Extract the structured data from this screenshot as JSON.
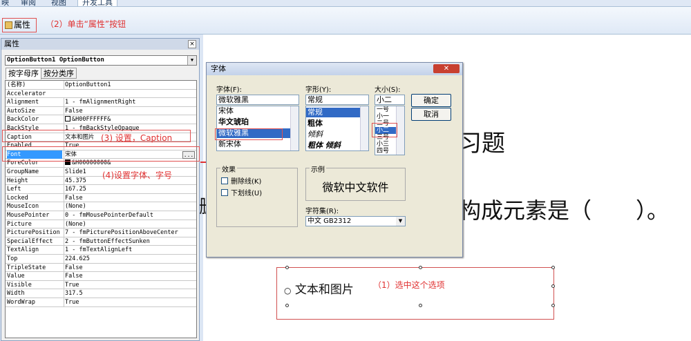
{
  "ribbon": {
    "tabs": [
      "映",
      "审阅",
      "视图",
      "开发工具"
    ],
    "properties_btn": "属性"
  },
  "annotations": {
    "a1": "（1）选中这个选项",
    "a2": "（2）单击“属性”按钮",
    "a3": "(3) 设置，Caption",
    "a4": "(4)设置字体、字号"
  },
  "props": {
    "title": "属性",
    "object": "OptionButton1 OptionButton",
    "tab_alpha": "按字母序",
    "tab_cat": "按分类序",
    "rows": [
      [
        "(名称)",
        "OptionButton1"
      ],
      [
        "Accelerator",
        ""
      ],
      [
        "Alignment",
        "1 - fmAlignmentRight"
      ],
      [
        "AutoSize",
        "False"
      ],
      [
        "BackColor",
        "&H00FFFFFF&"
      ],
      [
        "BackStyle",
        "1 - fmBackStyleOpaque"
      ],
      [
        "Caption",
        "文本和图片"
      ],
      [
        "Enabled",
        "True"
      ],
      [
        "Font",
        "宋体"
      ],
      [
        "ForeColor",
        "&H00000000&"
      ],
      [
        "GroupName",
        "Slide1"
      ],
      [
        "Height",
        "45.375"
      ],
      [
        "Left",
        "167.25"
      ],
      [
        "Locked",
        "False"
      ],
      [
        "MouseIcon",
        "(None)"
      ],
      [
        "MousePointer",
        "0 - fmMousePointerDefault"
      ],
      [
        "Picture",
        "(None)"
      ],
      [
        "PicturePosition",
        "7 - fmPicturePositionAboveCenter"
      ],
      [
        "SpecialEffect",
        "2 - fmButtonEffectSunken"
      ],
      [
        "TextAlign",
        "1 - fmTextAlignLeft"
      ],
      [
        "Top",
        "224.625"
      ],
      [
        "TripleState",
        "False"
      ],
      [
        "Value",
        "False"
      ],
      [
        "Visible",
        "True"
      ],
      [
        "Width",
        "317.5"
      ],
      [
        "WordWrap",
        "True"
      ]
    ]
  },
  "dialog": {
    "title": "字体",
    "font_label": "字体(F):",
    "font_value": "微软雅黑",
    "fonts": [
      "宋体",
      "华文琥珀",
      "微软雅黑",
      "新宋体"
    ],
    "style_label": "字形(Y):",
    "style_value": "常规",
    "styles": [
      "常规",
      "粗体",
      "倾斜",
      "粗体 倾斜"
    ],
    "size_label": "大小(S):",
    "size_value": "小二",
    "sizes": [
      "一号",
      "小一",
      "二号",
      "小二",
      "三号",
      "小三",
      "四号"
    ],
    "ok": "确定",
    "cancel": "取消",
    "effects": "效果",
    "strike": "删除线(K)",
    "underline": "下划线(U)",
    "sample": "示例",
    "sample_text": "微软中文软件",
    "charset_label": "字符集(R):",
    "charset": "中文 GB2312"
  },
  "slide": {
    "title_frag": "习题",
    "q_frag": "构成元素是（　　）。",
    "option": "文本和图片",
    "left_char": "删"
  },
  "colors": {
    "accent": "#e03030"
  }
}
